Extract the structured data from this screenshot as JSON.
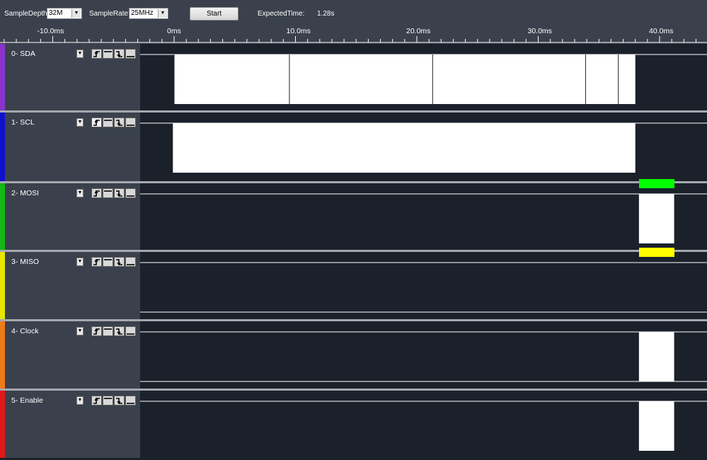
{
  "toolbar": {
    "sample_depth_label": "SampleDepth",
    "sample_depth_value": "32M",
    "sample_rate_label": "SampleRate",
    "sample_rate_value": "25MHz",
    "start_label": "Start",
    "expected_time_label": "ExpectedTime:",
    "expected_time_value": "1.28s"
  },
  "ruler": {
    "ticks": [
      "-10.0ms",
      "0ms",
      "10.0ms",
      "20.0ms",
      "30.0ms",
      "40.0ms"
    ]
  },
  "channels": [
    {
      "label": "0- SDA",
      "color": "#8a33cc",
      "high": [
        [
          0.0,
          0.1
        ],
        [
          9.5,
          0.1
        ],
        [
          21.3,
          0.1
        ],
        [
          33.9,
          0.1
        ],
        [
          36.6,
          0.1
        ]
      ],
      "bursts": [
        [
          0.0,
          38.0
        ]
      ]
    },
    {
      "label": "1- SCL",
      "color": "#1010cc",
      "high": [],
      "bursts": [
        [
          -0.1,
          38.0
        ]
      ]
    },
    {
      "label": "2- MOSI",
      "color": "#14b814",
      "high": [],
      "bursts": [
        [
          38.3,
          41.2
        ]
      ],
      "marker": {
        "color": "#00ff00",
        "range": [
          38.3,
          41.2
        ]
      }
    },
    {
      "label": "3- MISO",
      "color": "#e6e600",
      "high": [],
      "bursts": [],
      "marker": {
        "color": "#ffff00",
        "range": [
          38.3,
          41.2
        ]
      }
    },
    {
      "label": "4- Clock",
      "color": "#ee7a1a",
      "high": [],
      "bursts": [
        [
          38.3,
          41.2
        ]
      ]
    },
    {
      "label": "5- Enable",
      "color": "#e01818",
      "high": [],
      "bursts": [
        [
          38.3,
          41.2
        ]
      ]
    }
  ],
  "time_axis": {
    "unit": "ms",
    "xmin": -14.3,
    "xmax": 44.2
  }
}
